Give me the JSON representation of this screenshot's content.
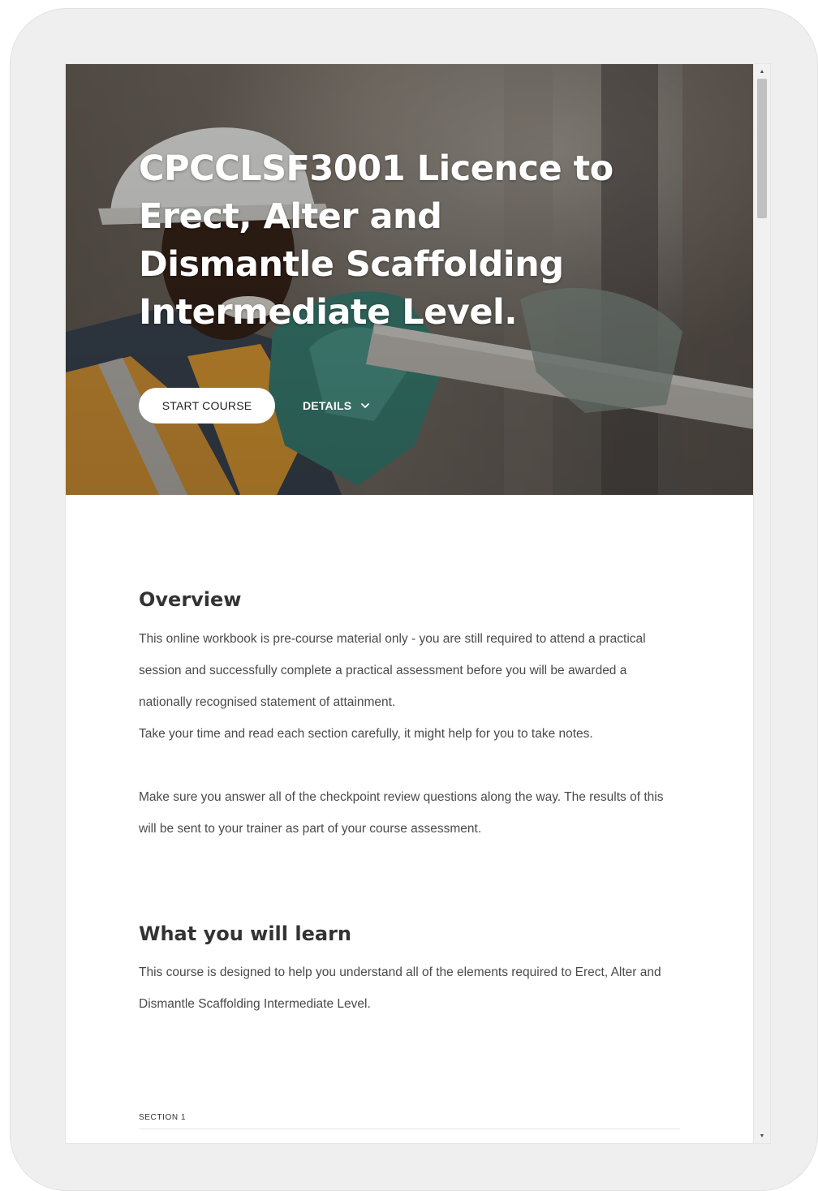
{
  "hero": {
    "title": "CPCCLSF3001 Licence to Erect, Alter and Dismantle Scaffolding Intermediate Level.",
    "start_button_label": "START COURSE",
    "details_button_label": "DETAILS"
  },
  "overview": {
    "heading": "Overview",
    "paragraph_1": "This online workbook is pre-course material only - you are still required to attend a practical session and successfully complete a practical assessment before you will be awarded a nationally recognised statement of attainment.",
    "paragraph_2": "Take your time and read each section carefully, it might help for you to take notes.",
    "paragraph_3": "Make sure you answer all of the checkpoint review questions along the way. The results of this will be sent to your trainer as part of your course assessment."
  },
  "learn": {
    "heading": "What you will learn",
    "paragraph": "This course is designed to help you understand all of the elements required to Erect, Alter and Dismantle Scaffolding Intermediate Level."
  },
  "section": {
    "label": "SECTION 1"
  },
  "icons": {
    "details_chevron": "chevron-down-icon",
    "scroll_up": "scroll-up-arrow-icon",
    "scroll_down": "scroll-down-arrow-icon"
  },
  "colors": {
    "device_frame": "#efefef",
    "hero_text": "#ffffff",
    "heading_text": "#333333",
    "body_text": "#4a4a4a",
    "high_vis_orange": "#e8a23a"
  }
}
